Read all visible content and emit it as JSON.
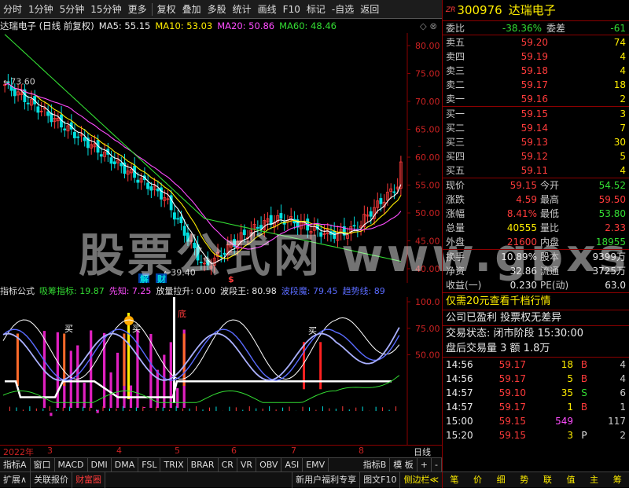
{
  "toolbar": {
    "items": [
      "分时",
      "1分钟",
      "5分钟",
      "15分钟",
      "更多",
      "复权",
      "叠加",
      "多股",
      "统计",
      "画线",
      "F10",
      "标记",
      "-自选",
      "返回"
    ]
  },
  "kline": {
    "stock_title": "达瑞电子 (日线 前复权)",
    "ma5": "MA5: 55.15",
    "ma10": "MA10: 53.03",
    "ma20": "MA20: 50.86",
    "ma60": "MA60: 48.46",
    "high_label": "73.60",
    "low_label": "39.40",
    "markers": [
      "解",
      "财",
      "$"
    ],
    "y_ticks": [
      "80.00",
      "75.00",
      "70.00",
      "65.00",
      "60.00",
      "55.00",
      "50.00",
      "45.00",
      "40.00"
    ],
    "colors": {
      "ma5": "#ffffff",
      "ma10": "#ffee00",
      "ma20": "#ff4dff",
      "ma60": "#33dd33",
      "up": "#ff3b3b",
      "down": "#00e0e0"
    }
  },
  "indicator": {
    "title": "指标公式",
    "items": [
      "吸筹指标: 19.87",
      "先知: 7.25",
      "放量拉升: 0.00",
      "波段王: 80.98",
      "波段魔: 79.45",
      "趋势线: 89"
    ],
    "y_ticks": [
      "100.0",
      "75.00",
      "50.00"
    ],
    "labels": [
      "买",
      "买",
      "买",
      "底"
    ]
  },
  "dates": {
    "year": "2022年",
    "months": [
      "3",
      "4",
      "5",
      "6",
      "7",
      "8"
    ],
    "right_label": "日线"
  },
  "tabs": [
    "指标A",
    "窗口",
    "MACD",
    "DMI",
    "DMA",
    "FSL",
    "TRIX",
    "BRAR",
    "CR",
    "VR",
    "OBV",
    "ASI",
    "EMV",
    "指标B",
    "模 板",
    "+",
    "-"
  ],
  "bottom": {
    "left": [
      "扩展∧",
      "关联报价",
      "财富圈"
    ],
    "right": [
      "新用户福利专享",
      "图文F10",
      "侧边栏≪"
    ]
  },
  "panel": {
    "code": "300976",
    "name": "达瑞电子",
    "badge": "ZR",
    "weibi_label": "委比",
    "weibi": "-38.36%",
    "weicha_label": "委差",
    "weicha": "-61",
    "asks": [
      {
        "label": "卖五",
        "price": "59.20",
        "vol": "74"
      },
      {
        "label": "卖四",
        "price": "59.19",
        "vol": "4"
      },
      {
        "label": "卖三",
        "price": "59.18",
        "vol": "4"
      },
      {
        "label": "卖二",
        "price": "59.17",
        "vol": "18"
      },
      {
        "label": "卖一",
        "price": "59.16",
        "vol": "2"
      }
    ],
    "bids": [
      {
        "label": "买一",
        "price": "59.15",
        "vol": "3"
      },
      {
        "label": "买二",
        "price": "59.14",
        "vol": "7"
      },
      {
        "label": "买三",
        "price": "59.13",
        "vol": "30"
      },
      {
        "label": "买四",
        "price": "59.12",
        "vol": "5"
      },
      {
        "label": "买五",
        "price": "59.11",
        "vol": "4"
      }
    ],
    "quote": [
      {
        "l1": "现价",
        "v1": "59.15",
        "c1": "red",
        "l2": "今开",
        "v2": "54.52",
        "c2": "green"
      },
      {
        "l1": "涨跌",
        "v1": "4.59",
        "c1": "red",
        "l2": "最高",
        "v2": "59.50",
        "c2": "red"
      },
      {
        "l1": "涨幅",
        "v1": "8.41%",
        "c1": "red",
        "l2": "最低",
        "v2": "53.80",
        "c2": "green"
      },
      {
        "l1": "总量",
        "v1": "40555",
        "c1": "yellow",
        "l2": "量比",
        "v2": "2.33",
        "c2": "red"
      },
      {
        "l1": "外盘",
        "v1": "21600",
        "c1": "red",
        "l2": "内盘",
        "v2": "18955",
        "c2": "green"
      }
    ],
    "stats": [
      {
        "l1": "换手",
        "v1": "10.89%",
        "l2": "股本",
        "v2": "9399万"
      },
      {
        "l1": "净资",
        "v1": "32.86",
        "l2": "流通",
        "v2": "3725万"
      },
      {
        "l1": "收益(一)",
        "v1": "0.230",
        "l2": "PE(动)",
        "v2": "63.0"
      }
    ],
    "promo": "仅需20元查看千档行情",
    "profit": "公司已盈利 投票权无差异",
    "status": "交易状态: 闭市阶段 15:30:00",
    "after": "盘后交易量 3 额 1.8万",
    "ticks": [
      {
        "t": "14:56",
        "p": "59.17",
        "v": "18",
        "s": "B",
        "n": "4"
      },
      {
        "t": "14:56",
        "p": "59.17",
        "v": "5",
        "s": "B",
        "n": "4"
      },
      {
        "t": "14:57",
        "p": "59.10",
        "v": "35",
        "s": "S",
        "n": "6"
      },
      {
        "t": "14:57",
        "p": "59.17",
        "v": "1",
        "s": "B",
        "n": "1"
      },
      {
        "t": "15:00",
        "p": "59.15",
        "v": "549",
        "s": "",
        "n": "117"
      },
      {
        "t": "15:20",
        "p": "59.15",
        "v": "3",
        "s": "P",
        "n": "2"
      }
    ],
    "bottom_tabs": [
      "笔",
      "价",
      "细",
      "势",
      "联",
      "值",
      "主",
      "筹"
    ]
  }
}
